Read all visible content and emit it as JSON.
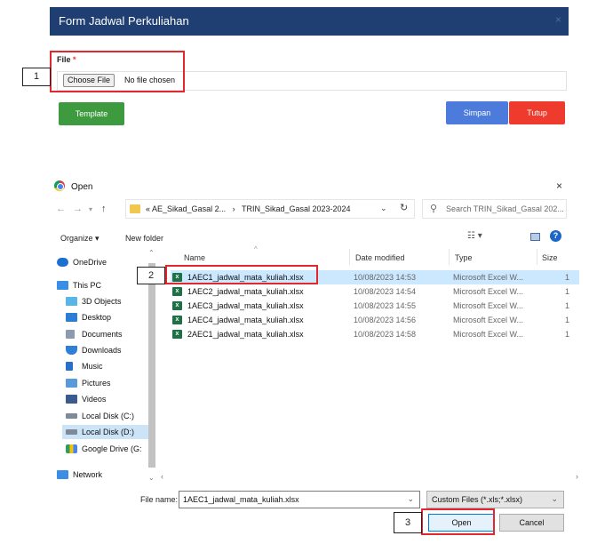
{
  "form": {
    "title": "Form Jadwal Perkuliahan",
    "close_glyph": "×",
    "file_label": "File",
    "required_mark": "*",
    "choose_button": "Choose File",
    "no_file_text": "No file chosen",
    "buttons": {
      "template": "Template",
      "simpan": "Simpan",
      "tutup": "Tutup"
    },
    "colors": {
      "header": "#1f3f73",
      "template": "#3d9a3e",
      "simpan": "#4c7bdc",
      "tutup": "#ef3b2d",
      "highlight": "#e0282e"
    }
  },
  "steps": {
    "one": "1",
    "two": "2",
    "three": "3"
  },
  "dialog": {
    "title": "Open",
    "close_glyph": "×",
    "address": {
      "prefix": "«",
      "segments": [
        "AE_Sikad_Gasal 2...",
        "TRIN_Sikad_Gasal 2023-2024"
      ],
      "separator": "›"
    },
    "search_placeholder": "Search TRIN_Sikad_Gasal 202...",
    "toolbar": {
      "organize": "Organize ▾",
      "new_folder": "New folder",
      "help": "?"
    },
    "nav_items": [
      {
        "label": "OneDrive",
        "icon": "cloud-icon",
        "color": "#1c6fd1"
      },
      {
        "label": "This PC",
        "icon": "computer-icon",
        "color": "#3a8ee6"
      },
      {
        "label": "3D Objects",
        "icon": "cube-icon",
        "color": "#59b4e8"
      },
      {
        "label": "Desktop",
        "icon": "desktop-icon",
        "color": "#2a7fd4"
      },
      {
        "label": "Documents",
        "icon": "document-icon",
        "color": "#8a9bb0"
      },
      {
        "label": "Downloads",
        "icon": "download-icon",
        "color": "#2f7fd8"
      },
      {
        "label": "Music",
        "icon": "music-icon",
        "color": "#2a6ecc"
      },
      {
        "label": "Pictures",
        "icon": "picture-icon",
        "color": "#5a9ad8"
      },
      {
        "label": "Videos",
        "icon": "video-icon",
        "color": "#3b5b8f"
      },
      {
        "label": "Local Disk (C:)",
        "icon": "drive-icon",
        "color": "#7e8a97"
      },
      {
        "label": "Local Disk (D:)",
        "icon": "drive-icon",
        "color": "#7e8a97"
      },
      {
        "label": "Google Drive (G:",
        "icon": "google-drive-icon",
        "color": "#2f9e5a"
      },
      {
        "label": "Network",
        "icon": "network-icon",
        "color": "#3a8ee6"
      }
    ],
    "columns": {
      "name": "Name",
      "date": "Date modified",
      "type": "Type",
      "size": "Size"
    },
    "files": [
      {
        "name": "1AEC1_jadwal_mata_kuliah.xlsx",
        "date": "10/08/2023 14:53",
        "type": "Microsoft Excel W...",
        "size": "1"
      },
      {
        "name": "1AEC2_jadwal_mata_kuliah.xlsx",
        "date": "10/08/2023 14:54",
        "type": "Microsoft Excel W...",
        "size": "1"
      },
      {
        "name": "1AEC3_jadwal_mata_kuliah.xlsx",
        "date": "10/08/2023 14:55",
        "type": "Microsoft Excel W...",
        "size": "1"
      },
      {
        "name": "1AEC4_jadwal_mata_kuliah.xlsx",
        "date": "10/08/2023 14:56",
        "type": "Microsoft Excel W...",
        "size": "1"
      },
      {
        "name": "2AEC1_jadwal_mata_kuliah.xlsx",
        "date": "10/08/2023 14:58",
        "type": "Microsoft Excel W...",
        "size": "1"
      }
    ],
    "file_name_label": "File name:",
    "file_name_value": "1AEC1_jadwal_mata_kuliah.xlsx",
    "filter": "Custom Files (*.xls;*.xlsx)",
    "open_button": "Open",
    "cancel_button": "Cancel"
  }
}
